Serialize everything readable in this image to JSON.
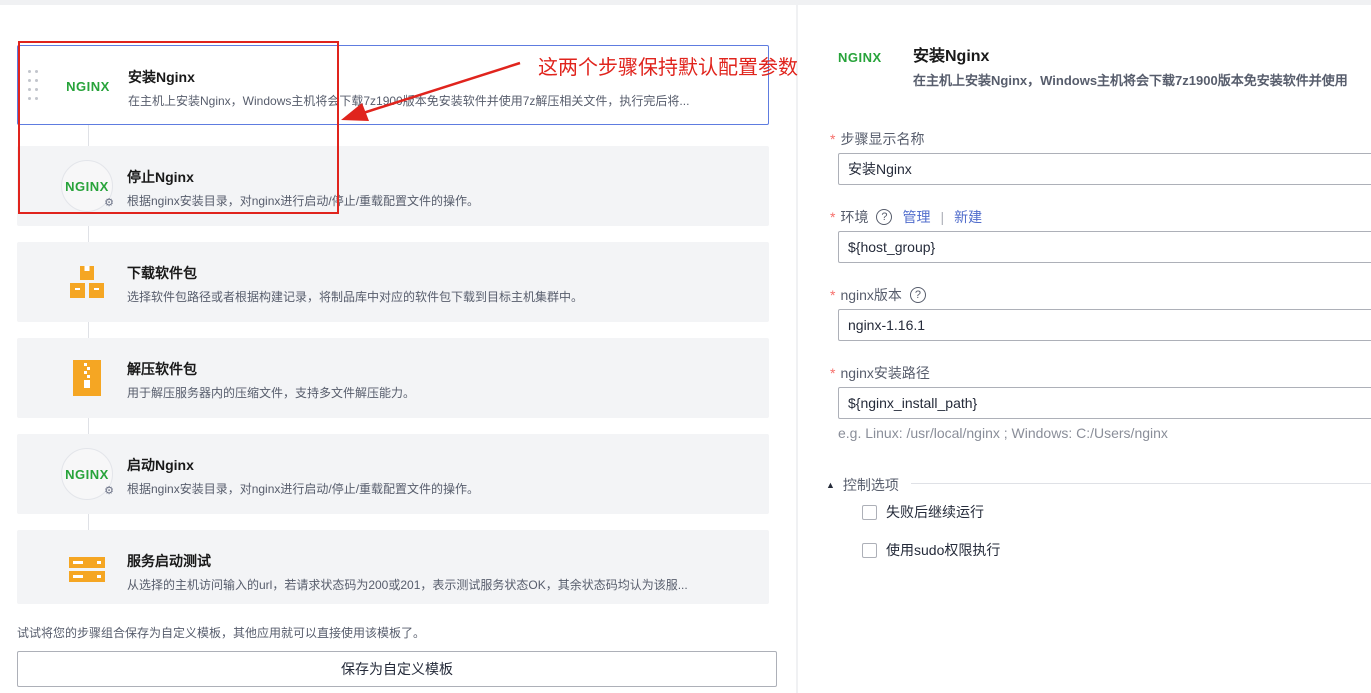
{
  "steps": [
    {
      "title": "安装Nginx",
      "desc": "在主机上安装Nginx，Windows主机将会下载7z1900版本免安装软件并使用7z解压相关文件，执行完后将...",
      "icon": "nginx-icon",
      "logo_text": "NGINX"
    },
    {
      "title": "停止Nginx",
      "desc": "根据nginx安装目录，对nginx进行启动/停止/重载配置文件的操作。",
      "icon": "nginx-icon",
      "logo_text": "NGINX"
    },
    {
      "title": "下载软件包",
      "desc": "选择软件包路径或者根据构建记录，将制品库中对应的软件包下载到目标主机集群中。",
      "icon": "package-boxes-icon"
    },
    {
      "title": "解压软件包",
      "desc": "用于解压服务器内的压缩文件，支持多文件解压能力。",
      "icon": "zip-file-icon"
    },
    {
      "title": "启动Nginx",
      "desc": "根据nginx安装目录，对nginx进行启动/停止/重载配置文件的操作。",
      "icon": "nginx-icon",
      "logo_text": "NGINX"
    },
    {
      "title": "服务启动测试",
      "desc": "从选择的主机访问输入的url，若请求状态码为200或201，表示测试服务状态OK，其余状态码均认为该服...",
      "icon": "server-icon"
    }
  ],
  "annotation": "这两个步骤保持默认配置参数即可",
  "hint": "试试将您的步骤组合保存为自定义模板，其他应用就可以直接使用该模板了。",
  "save_button": "保存为自定义模板",
  "detail": {
    "logo_text": "NGINX",
    "title": "安装Nginx",
    "subtitle": "在主机上安装Nginx，Windows主机将会下载7z1900版本免安装软件并使用",
    "fields": {
      "name_label": "步骤显示名称",
      "name_value": "安装Nginx",
      "env_label": "环境",
      "env_manage": "管理",
      "env_sep": "|",
      "env_new": "新建",
      "env_value": "${host_group}",
      "version_label": "nginx版本",
      "version_value": "nginx-1.16.1",
      "path_label": "nginx安装路径",
      "path_value": "${nginx_install_path}",
      "path_example": "e.g. Linux: /usr/local/nginx ; Windows: C:/Users/nginx",
      "required_mark": "*",
      "help_mark": "?"
    },
    "control": {
      "label": "控制选项",
      "options": [
        "失败后继续运行",
        "使用sudo权限执行"
      ]
    }
  },
  "colors": {
    "accent": "#5e7ce0",
    "annotation_red": "#e0241d",
    "nginx_green": "#27a33a",
    "icon_orange": "#f5a623"
  }
}
